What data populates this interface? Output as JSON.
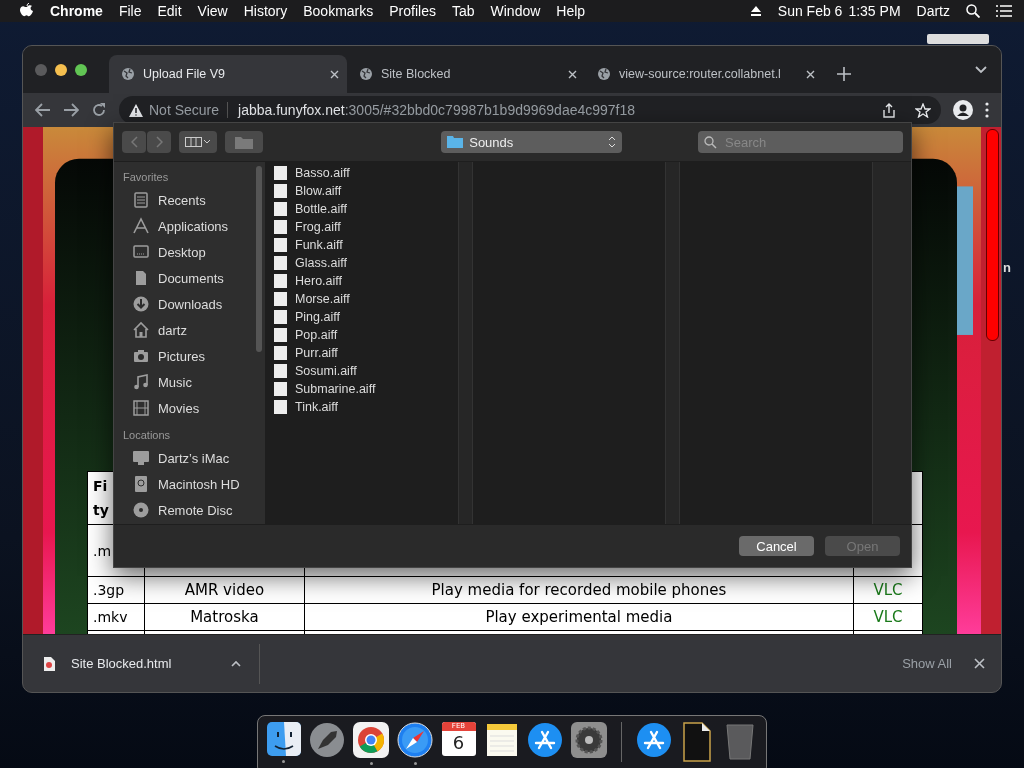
{
  "menu_bar": {
    "app": "Chrome",
    "menus": [
      "File",
      "Edit",
      "View",
      "History",
      "Bookmarks",
      "Profiles",
      "Tab",
      "Window",
      "Help"
    ],
    "date": "Sun Feb 6",
    "time": "1:35 PM",
    "user": "Dartz"
  },
  "desktop": {
    "label_fragment": "n"
  },
  "browser": {
    "tabs": [
      {
        "title": "Upload File V9",
        "selected": true
      },
      {
        "title": "Site Blocked",
        "selected": false
      },
      {
        "title": "view-source:router.collabnet.l",
        "selected": false
      }
    ],
    "address": {
      "security": "Not Secure",
      "host": "jabba.funyfox.net",
      "path": ":3005/#32bbd0c79987b1b9d9969dae4c997f18"
    },
    "page": {
      "table": {
        "header_fragments": [
          "Fi",
          "ty"
        ],
        "rows": [
          {
            "cells": [
              ".m"
            ]
          },
          {
            "cells": [
              ".3gp",
              "AMR video",
              "Play media for recorded mobile phones",
              "VLC"
            ]
          },
          {
            "cells": [
              ".mkv",
              "Matroska",
              "Play experimental media",
              "VLC"
            ]
          }
        ]
      }
    },
    "download_bar": {
      "file": "Site Blocked.html",
      "show_all": "Show All"
    }
  },
  "dialog": {
    "location": "Sounds",
    "search": {
      "placeholder": "Search"
    },
    "sidebar": [
      {
        "heading": "Favorites",
        "items": [
          {
            "label": "Recents",
            "kind": "recents"
          },
          {
            "label": "Applications",
            "kind": "applications"
          },
          {
            "label": "Desktop",
            "kind": "desktop"
          },
          {
            "label": "Documents",
            "kind": "documents"
          },
          {
            "label": "Downloads",
            "kind": "downloads"
          },
          {
            "label": "dartz",
            "kind": "home"
          },
          {
            "label": "Pictures",
            "kind": "pictures"
          },
          {
            "label": "Music",
            "kind": "music"
          },
          {
            "label": "Movies",
            "kind": "movies"
          }
        ]
      },
      {
        "heading": "Locations",
        "items": [
          {
            "label": "Dartz’s iMac",
            "kind": "computer"
          },
          {
            "label": "Macintosh HD",
            "kind": "disk"
          },
          {
            "label": "Remote Disc",
            "kind": "disc"
          }
        ]
      }
    ],
    "files": [
      "Basso.aiff",
      "Blow.aiff",
      "Bottle.aiff",
      "Frog.aiff",
      "Funk.aiff",
      "Glass.aiff",
      "Hero.aiff",
      "Morse.aiff",
      "Ping.aiff",
      "Pop.aiff",
      "Purr.aiff",
      "Sosumi.aiff",
      "Submarine.aiff",
      "Tink.aiff"
    ],
    "buttons": [
      {
        "label": "Cancel",
        "disabled": false
      },
      {
        "label": "Open",
        "disabled": true
      }
    ]
  },
  "dock": [
    {
      "kind": "finder",
      "running": true
    },
    {
      "kind": "launchpad",
      "running": false
    },
    {
      "kind": "chrome",
      "running": true
    },
    {
      "kind": "safari",
      "running": true
    },
    {
      "kind": "calendar",
      "running": false,
      "month": "FEB",
      "day": "6"
    },
    {
      "kind": "notes",
      "running": false
    },
    {
      "kind": "appstore",
      "running": false
    },
    {
      "kind": "settings",
      "running": false
    },
    {
      "kind": "separator"
    },
    {
      "kind": "appstore",
      "running": false
    },
    {
      "kind": "document",
      "running": false
    },
    {
      "kind": "trash",
      "running": false
    }
  ]
}
